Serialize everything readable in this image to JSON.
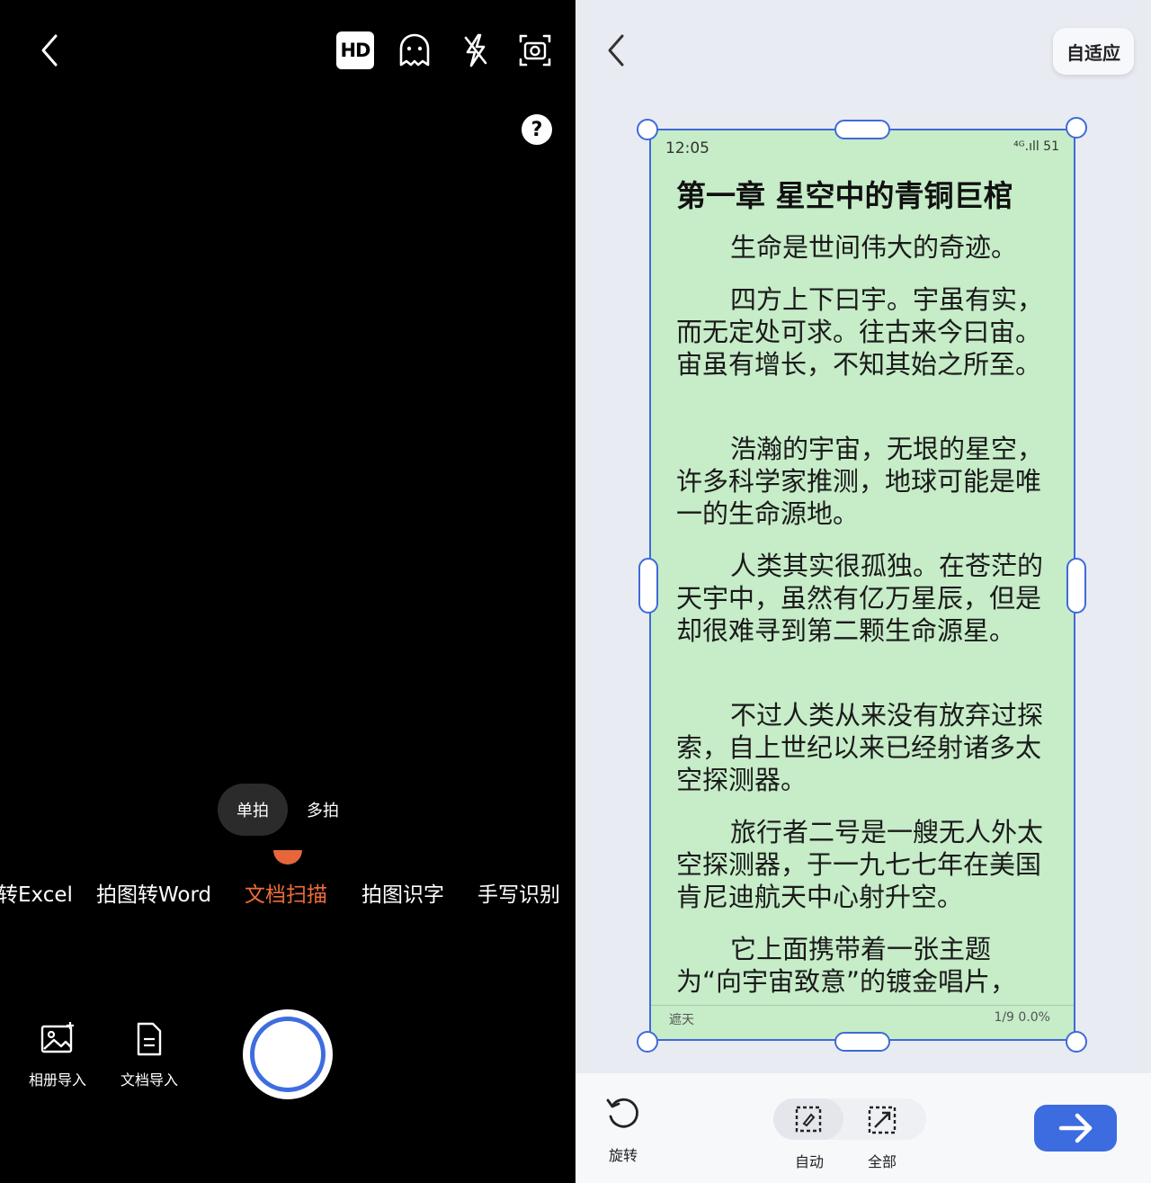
{
  "camera": {
    "hd_label": "HD",
    "help_label": "?",
    "mode_single": "单拍",
    "mode_multi": "多拍",
    "tools": [
      "转Excel",
      "拍图转Word",
      "文档扫描",
      "拍图识字",
      "手写识别"
    ],
    "active_tool_index": 2,
    "album_import": "相册导入",
    "doc_import": "文档导入"
  },
  "editor": {
    "adaptive_label": "自适应",
    "rotate_label": "旋转",
    "auto_label": "自动",
    "all_label": "全部"
  },
  "document": {
    "time": "12:05",
    "signal": "⁴ᴳ.ıll 51",
    "title": "第一章 星空中的青铜巨棺",
    "paragraphs": [
      "生命是世间伟大的奇迹。",
      "四方上下曰宇。宇虽有实，而无定处可求。往古来今曰宙。宙虽有增长，不知其始之所至。",
      "浩瀚的宇宙，无垠的星空，许多科学家推测，地球可能是唯一的生命源地。",
      "人类其实很孤独。在苍茫的天宇中，虽然有亿万星辰，但是却很难寻到第二颗生命源星。",
      "不过人类从来没有放弃过探索，自上世纪以来已经射诸多太空探测器。",
      "旅行者二号是一艘无人外太空探测器，于一九七七年在美国肯尼迪航天中心射升空。",
      "它上面携带着一张主题为“向宇宙致意”的镀金唱片，"
    ],
    "footer_left": "遮天",
    "footer_right": "1/9  0.0%"
  },
  "colors": {
    "accent_orange": "#ef6c3a",
    "accent_blue": "#3d6be0",
    "doc_bg": "#c6ecc8"
  }
}
